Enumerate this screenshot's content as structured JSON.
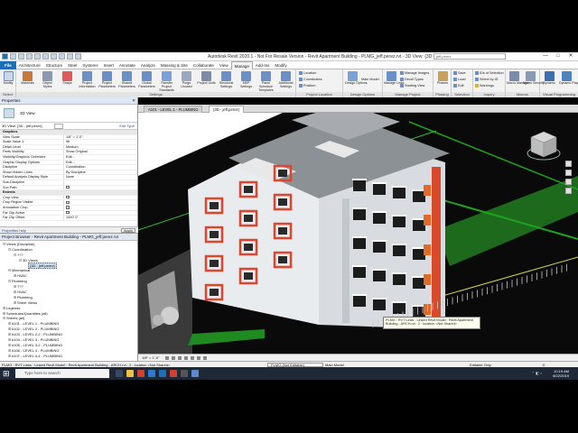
{
  "title": "Autodesk Revit 2020.1 - Not For Resale Version - Revit Apartment Building - PLMG_jeff.perez.rvt - 3D View: {3D - jeff.perez}",
  "search_placeholder": "jeff.perez",
  "window_controls": {
    "minimize": "—",
    "maximize": "□",
    "close": "✕"
  },
  "menu": [
    "File",
    "Architecture",
    "Structure",
    "Steel",
    "Systems",
    "Insert",
    "Annotate",
    "Analyze",
    "Massing & Site",
    "Collaborate",
    "View",
    "Manage",
    "Add-Ins",
    "Modify"
  ],
  "active_menu": "Manage",
  "ribbon": {
    "modify": {
      "label": "Modify",
      "panel": "Select"
    },
    "settings": {
      "panel": "Settings",
      "buttons": [
        "Materials",
        "Object Styles",
        "Snaps",
        "Project Information",
        "Project Parameters",
        "Shared Parameters",
        "Global Parameters",
        "Transfer Project Standards",
        "Purge Unused",
        "Project Units",
        "Structural Settings",
        "MEP Settings",
        "Panel Schedule Templates",
        "Additional Settings"
      ]
    },
    "project_location": {
      "panel": "Project Location",
      "items": [
        "Location",
        "Coordinates",
        "Position"
      ]
    },
    "design_options": {
      "panel": "Design Options",
      "items": [
        "Design Options",
        "Main Model"
      ]
    },
    "manage_project": {
      "panel": "Manage Project",
      "items": [
        "Manage Links",
        "Manage Images",
        "Decal Types",
        "Starting View"
      ]
    },
    "phasing": {
      "panel": "Phasing",
      "items": [
        "Phases"
      ]
    },
    "selection": {
      "panel": "Selection",
      "items": [
        "Save",
        "Load",
        "Edit"
      ]
    },
    "inquiry": {
      "panel": "Inquiry",
      "items": [
        "IDs of Selection",
        "Select by ID",
        "Warnings"
      ]
    },
    "macros": {
      "panel": "Macros",
      "items": [
        "Macro Manager",
        "Macro Security"
      ]
    },
    "visual_programming": {
      "panel": "Visual Programming",
      "items": [
        "Dynamo",
        "Dynamo Player"
      ]
    }
  },
  "properties": {
    "header": "Properties",
    "close": "✕",
    "type_name": "3D View",
    "filter": "3D View: {3D - jeff.perez}",
    "edit_type": "Edit Type",
    "rows": [
      {
        "group": true,
        "k": "Graphics",
        "v": ""
      },
      {
        "k": "View Scale",
        "v": "1/8\" = 1'-0\""
      },
      {
        "k": "Scale Value 1:",
        "v": "96"
      },
      {
        "k": "Detail Level",
        "v": "Medium"
      },
      {
        "k": "Parts Visibility",
        "v": "Show Original"
      },
      {
        "k": "Visibility/Graphics Overrides",
        "v": "Edit..."
      },
      {
        "k": "Graphic Display Options",
        "v": "Edit..."
      },
      {
        "k": "Discipline",
        "v": "Coordination"
      },
      {
        "k": "Show Hidden Lines",
        "v": "By Discipline"
      },
      {
        "k": "Default Analysis Display Style",
        "v": "None"
      },
      {
        "k": "Sub-Discipline",
        "v": ""
      },
      {
        "k": "Sun Path",
        "v": "",
        "cb": "off"
      },
      {
        "group": true,
        "k": "Extents",
        "v": ""
      },
      {
        "k": "Crop View",
        "v": "",
        "cb": "off"
      },
      {
        "k": "Crop Region Visible",
        "v": "",
        "cb": "off"
      },
      {
        "k": "Annotation Crop",
        "v": "",
        "cb": "off"
      },
      {
        "k": "Far Clip Active",
        "v": "",
        "cb": "off"
      },
      {
        "k": "Far Clip Offset",
        "v": "1000' 0\""
      }
    ],
    "help_link": "Properties help",
    "apply": "Apply"
  },
  "browser": {
    "header": "Project Browser - Revit Apartment Building - PLMG_jeff.perez.rvt",
    "nodes": [
      {
        "d": 0,
        "tg": "⊟",
        "t": "Views (Discipline)"
      },
      {
        "d": 1,
        "tg": "⊟",
        "t": "Coordination"
      },
      {
        "d": 2,
        "tg": "⊟",
        "t": "???"
      },
      {
        "d": 3,
        "tg": "⊟",
        "t": "3D Views"
      },
      {
        "d": 4,
        "tg": "",
        "t": "{3D - jeff.perez}",
        "sel": true
      },
      {
        "d": 1,
        "tg": "⊟",
        "t": "Mechanical"
      },
      {
        "d": 2,
        "tg": "⊞",
        "t": "HVAC"
      },
      {
        "d": 1,
        "tg": "⊟",
        "t": "Plumbing"
      },
      {
        "d": 2,
        "tg": "⊞",
        "t": "???"
      },
      {
        "d": 2,
        "tg": "⊞",
        "t": "HVAC"
      },
      {
        "d": 2,
        "tg": "⊞",
        "t": "Plumbing"
      },
      {
        "d": 2,
        "tg": "⊞",
        "t": "Sheet Views"
      },
      {
        "d": 0,
        "tg": "⊞",
        "t": "Legends"
      },
      {
        "d": 0,
        "tg": "⊞",
        "t": "Schedules/Quantities (all)"
      },
      {
        "d": 0,
        "tg": "⊟",
        "t": "Sheets (all)"
      },
      {
        "d": 1,
        "tg": "⊞",
        "t": "#101 - LEVEL 1 - PLUMBING"
      },
      {
        "d": 1,
        "tg": "⊞",
        "t": "#102 - LEVEL 2 - PLUMBING"
      },
      {
        "d": 1,
        "tg": "⊞",
        "t": "#103 - LEVEL 2-2 - PLUMBING"
      },
      {
        "d": 1,
        "tg": "⊞",
        "t": "#104 - LEVEL 3 - PLUMBING"
      },
      {
        "d": 1,
        "tg": "⊞",
        "t": "#105 - LEVEL 3-2 - PLUMBING"
      },
      {
        "d": 1,
        "tg": "⊞",
        "t": "#106 - LEVEL 4 - PLUMBING"
      },
      {
        "d": 1,
        "tg": "⊞",
        "t": "#107 - LEVEL 4-4 - PLUMBING"
      }
    ]
  },
  "view_tabs": [
    {
      "label": "A101 - LEVEL 1 - PLUMBING",
      "active": false
    },
    {
      "label": "{3D - jeff.perez}",
      "active": true
    }
  ],
  "view_control": {
    "scale": "1/8\" = 1'-0\""
  },
  "tooltip": "PLMG : RVT Links : Linked Revit Model : Revit Apartment Building - ARCH.rvt : 2 : location <Not Shared>",
  "status": {
    "message": "PLMG : RVT Links : Linked Revit Model : Revit Apartment Building - ARCH.rvt : 2 : location <Not Shared>",
    "model": "Main Model",
    "workset": "PLMG (Not Editable)",
    "editable_only": "Editable Only",
    "zoom": ":0"
  },
  "taskbar": {
    "search": "Type here to search",
    "time": "10:19 AM",
    "date": "8/22/2019"
  }
}
